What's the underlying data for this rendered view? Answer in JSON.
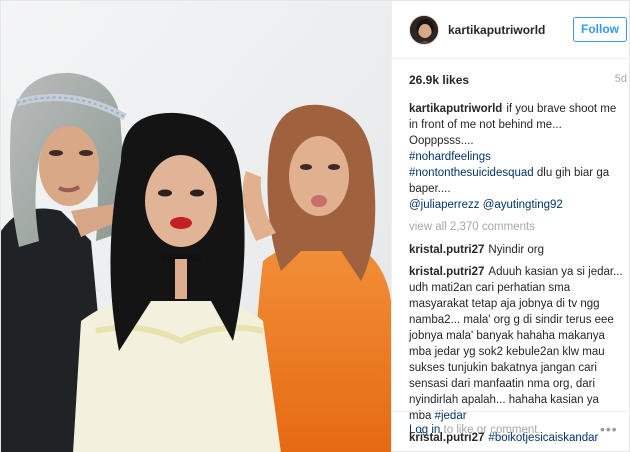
{
  "header": {
    "username": "kartikaputriworld",
    "follow_label": "Follow"
  },
  "stats": {
    "likes": "26.9k likes",
    "age": "5d"
  },
  "caption": {
    "user": "kartikaputriworld",
    "lines": [
      "if you brave shoot me",
      "in front of me not behind me...",
      "Oopppsss....",
      "#nohardfeelings",
      "#nontonthesuicidesquad",
      " dlu gih biar ga",
      "baper....",
      "@juliaperrezz",
      "@ayutingting92"
    ]
  },
  "view_all": "view all 2,370 comments",
  "comments": [
    {
      "user": "kristal.putri27",
      "text": "Nyindir org"
    },
    {
      "user": "kristal.putri27",
      "lines": [
        "Aduuh kasian ya si jedar...",
        "udh mati2an cari perhatian sma",
        "masyarakat tetap aja jobnya di tv ngg",
        "namba2... mala' org g di sindir terus eee",
        "jobnya mala' banyak hahaha makanya",
        "mba jedar yg sok2 kebule2an klw mau",
        "sukses tunjukin bakatnya jangan cari",
        "sensasi dari manfaatin nma org, dari",
        "nyindirlah apalah... hahaha kasian ya",
        "mba "
      ],
      "tag": "#jedar"
    },
    {
      "user": "kristal.putri27",
      "tag": "#boikotjesicaiskandar"
    }
  ],
  "footer": {
    "login_link": "Log in",
    "login_rest": " to like or comment.",
    "more": "•••"
  },
  "colors": {
    "follow_blue": "#3897f0",
    "hashtag": "#003569",
    "muted": "#a5a7aa",
    "text": "#262626"
  },
  "icons": {
    "more": "more-options-icon"
  }
}
